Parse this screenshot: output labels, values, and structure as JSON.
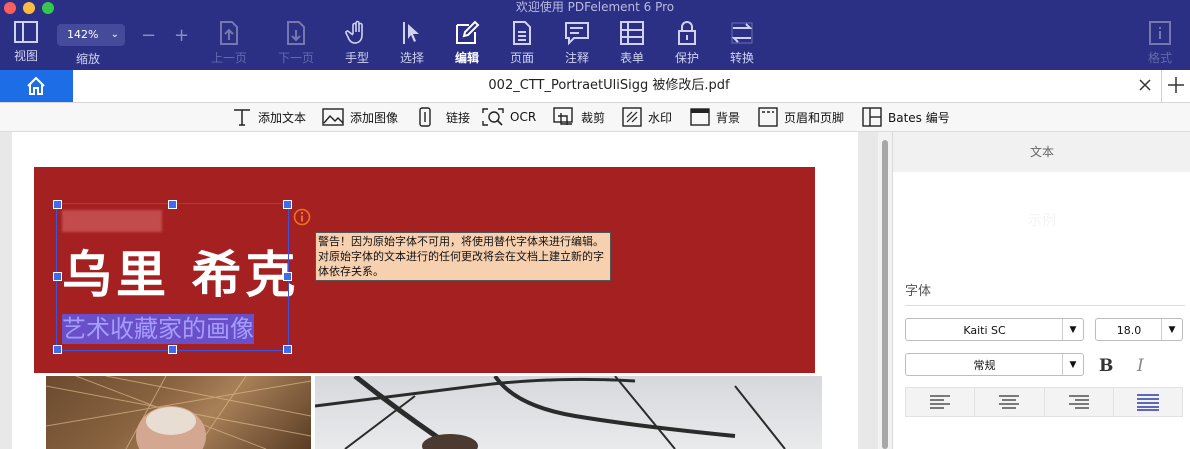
{
  "window": {
    "title": "欢迎使用 PDFelement 6 Pro",
    "traffic_colors": [
      "#fc605c",
      "#fdbc40",
      "#34c84a"
    ]
  },
  "toolbar": {
    "view_label": "视图",
    "zoom_label": "缩放",
    "zoom_value": "142%",
    "zoom_out": "−",
    "zoom_in": "+",
    "prev_page": "上一页",
    "next_page": "下一页",
    "hand": "手型",
    "select": "选择",
    "edit": "编辑",
    "page": "页面",
    "comment": "注释",
    "form": "表单",
    "protect": "保护",
    "convert": "转换",
    "format": "格式"
  },
  "tab": {
    "filename": "002_CTT_PortraetUliSigg 被修改后.pdf"
  },
  "edit_tools": {
    "add_text": "添加文本",
    "add_image": "添加图像",
    "link": "链接",
    "ocr": "OCR",
    "crop": "裁剪",
    "watermark": "水印",
    "background": "背景",
    "header_footer": "页眉和页脚",
    "bates": "Bates 编号"
  },
  "document": {
    "name_heading": "乌里 希克",
    "subtitle": "艺术收藏家的画像",
    "warning": "警告！因为原始字体不可用，将使用替代字体来进行编辑。对原始字体的文本进行的任何更改将会在文档上建立新的字体依存关系。",
    "accent_color": "#a52121"
  },
  "panel": {
    "header": "文本",
    "sample": "示例",
    "font_section": "字体",
    "font_family": "Kaiti SC",
    "font_size": "18.0",
    "font_style": "常规",
    "bold": "B",
    "italic": "I"
  }
}
